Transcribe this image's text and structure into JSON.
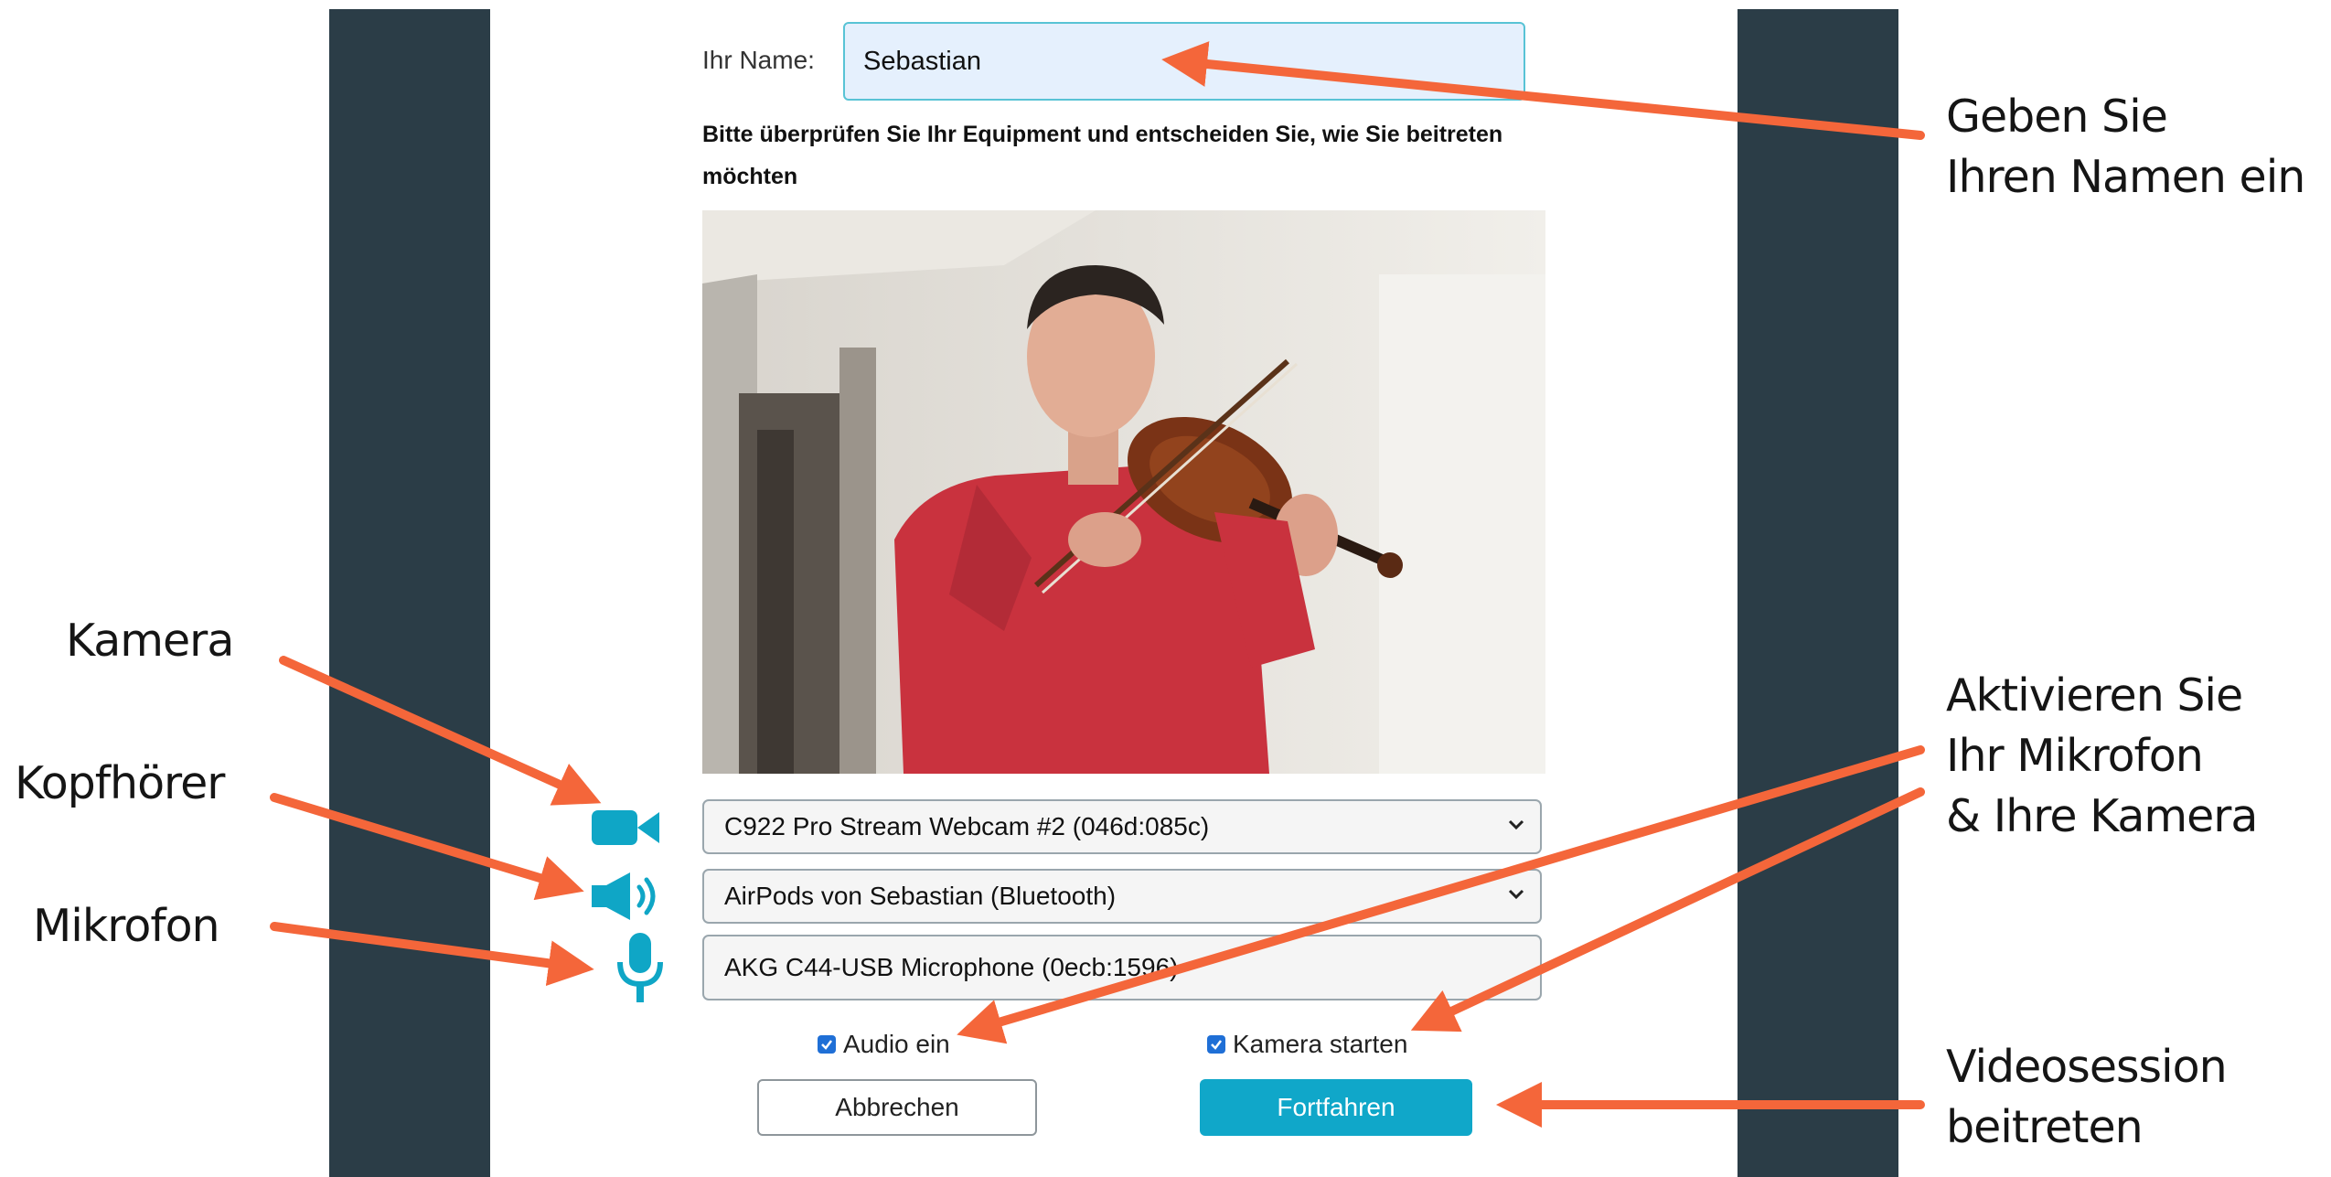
{
  "form": {
    "name_label": "Ihr Name:",
    "name_value": "Sebastian",
    "instruction": "Bitte überprüfen Sie Ihr Equipment und entscheiden Sie, wie Sie beitreten möchten",
    "camera_device": "C922 Pro Stream Webcam #2 (046d:085c)",
    "speaker_device": "AirPods von Sebastian (Bluetooth)",
    "mic_device": "AKG C44-USB Microphone (0ecb:1596)",
    "audio_checkbox_label": "Audio ein",
    "audio_checked": true,
    "camera_checkbox_label": "Kamera starten",
    "camera_checked": true,
    "cancel_label": "Abbrechen",
    "continue_label": "Fortfahren"
  },
  "annotations": {
    "name_line1": "Geben Sie",
    "name_line2": "Ihren Namen ein",
    "camera": "Kamera",
    "headphones": "Kopfhörer",
    "microphone": "Mikrofon",
    "activate_line1": "Aktivieren Sie",
    "activate_line2": "Ihr Mikrofon",
    "activate_line3": "& Ihre Kamera",
    "join_line1": "Videosession",
    "join_line2": "beitreten"
  },
  "colors": {
    "pillar": "#2b3d47",
    "accent": "#10a7c9",
    "arrow": "#f4663a",
    "icon": "#0fa6c6"
  },
  "icons": {
    "camera": "video-camera-icon",
    "speaker": "speaker-icon",
    "microphone": "microphone-icon"
  }
}
